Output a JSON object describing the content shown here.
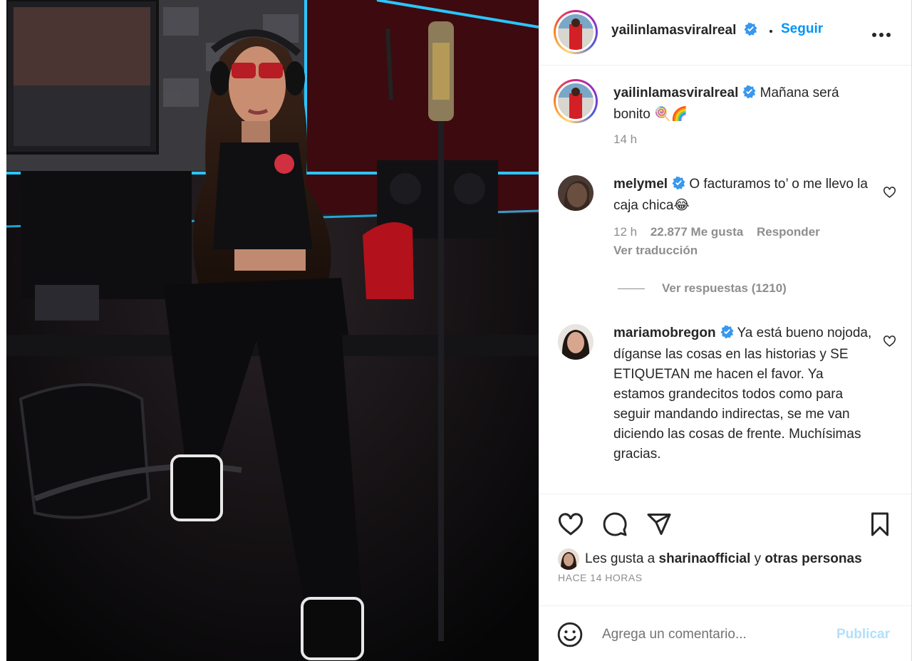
{
  "post": {
    "author": "yailinlamasviralreal",
    "follow_label": "Seguir",
    "caption": "Mañana será bonito 🍭🌈",
    "caption_time": "14 h",
    "icons": {
      "more": "more-options-icon",
      "verified": "verified-badge-icon"
    }
  },
  "comments": [
    {
      "user": "melymel",
      "text": "O facturamos to’ o me llevo la caja chica😂",
      "time": "12 h",
      "likes": "22.877 Me gusta",
      "reply_label": "Responder",
      "translate_label": "Ver traducción",
      "view_replies_label": "Ver respuestas (1210)"
    },
    {
      "user": "mariamobregon",
      "text": "Ya está bueno nojoda, díganse las cosas en las historias y SE ETIQUETAN me hacen el favor. Ya estamos grandecitos todos como para seguir mandando indirectas, se me van diciendo las cosas de frente. Muchísimas gracias."
    }
  ],
  "actions": {
    "icons": [
      "heart-icon",
      "comment-icon",
      "share-icon",
      "bookmark-icon"
    ],
    "likes_prefix": "Les gusta a",
    "liked_by_user": "sharinaofficial",
    "likes_conjunction": "y",
    "likes_suffix": "otras personas",
    "time_ago": "HACE 14 HORAS"
  },
  "composer": {
    "placeholder": "Agrega un comentario...",
    "publish_label": "Publicar"
  },
  "colors": {
    "link_blue": "#0095f6",
    "publish_disabled": "#b2dffc",
    "secondary_text": "#8e8e8e",
    "verified_blue": "#3897f0"
  }
}
